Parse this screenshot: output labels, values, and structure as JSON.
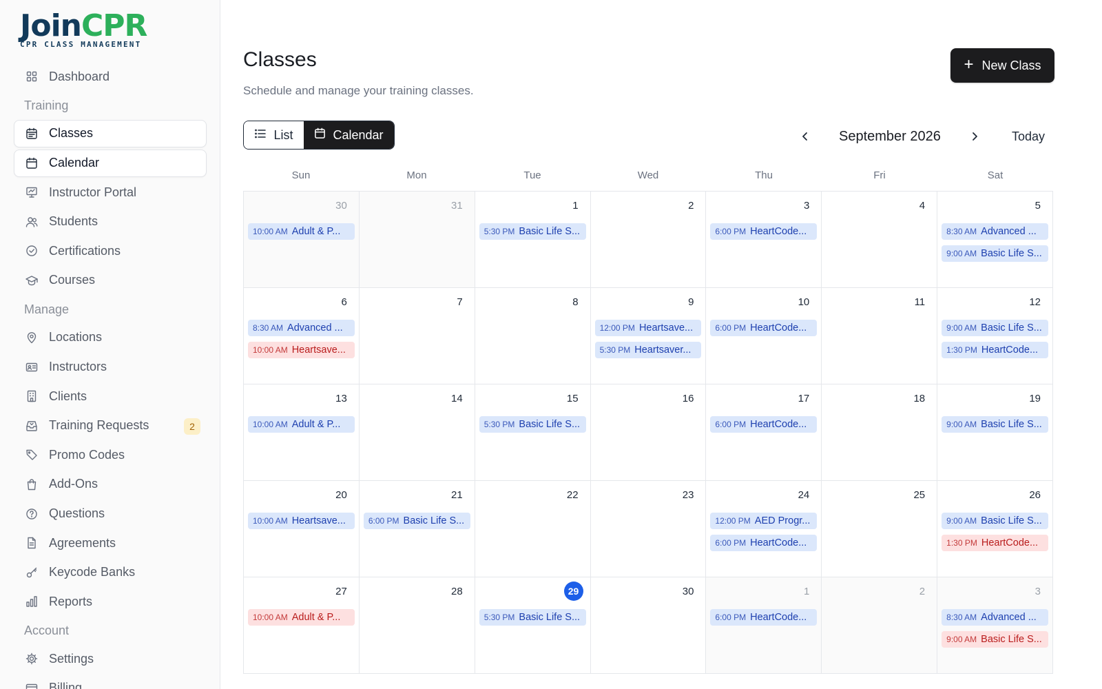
{
  "brand": {
    "word_1": "Join",
    "word_2": "CPR",
    "tagline": "CPR CLASS MANAGEMENT"
  },
  "sidebar": {
    "items": [
      {
        "type": "item",
        "label": "Dashboard",
        "icon": "dashboard-icon"
      },
      {
        "type": "section",
        "label": "Training"
      },
      {
        "type": "item",
        "label": "Classes",
        "icon": "classes-icon",
        "active": true
      },
      {
        "type": "item",
        "label": "Calendar",
        "icon": "calendar-icon",
        "active": true
      },
      {
        "type": "item",
        "label": "Instructor Portal",
        "icon": "presentation-icon"
      },
      {
        "type": "item",
        "label": "Students",
        "icon": "users-icon"
      },
      {
        "type": "item",
        "label": "Certifications",
        "icon": "badge-check-icon"
      },
      {
        "type": "item",
        "label": "Courses",
        "icon": "graduation-cap-icon"
      },
      {
        "type": "section",
        "label": "Manage"
      },
      {
        "type": "item",
        "label": "Locations",
        "icon": "map-pin-icon"
      },
      {
        "type": "item",
        "label": "Instructors",
        "icon": "id-card-icon"
      },
      {
        "type": "item",
        "label": "Clients",
        "icon": "building-icon"
      },
      {
        "type": "item",
        "label": "Training Requests",
        "icon": "inbox-icon",
        "badge": "2"
      },
      {
        "type": "item",
        "label": "Promo Codes",
        "icon": "tag-icon"
      },
      {
        "type": "item",
        "label": "Add-Ons",
        "icon": "shopping-bag-icon"
      },
      {
        "type": "item",
        "label": "Questions",
        "icon": "help-circle-icon"
      },
      {
        "type": "item",
        "label": "Agreements",
        "icon": "file-text-icon"
      },
      {
        "type": "item",
        "label": "Keycode Banks",
        "icon": "key-icon"
      },
      {
        "type": "item",
        "label": "Reports",
        "icon": "bar-chart-icon"
      },
      {
        "type": "section",
        "label": "Account"
      },
      {
        "type": "item",
        "label": "Settings",
        "icon": "gear-icon"
      },
      {
        "type": "item",
        "label": "Billing",
        "icon": "credit-card-icon"
      }
    ]
  },
  "header": {
    "title": "Classes",
    "subtitle": "Schedule and manage your training classes.",
    "new_button_label": "New Class"
  },
  "view_toggle": {
    "list_label": "List",
    "calendar_label": "Calendar",
    "selected": "Calendar"
  },
  "month_nav": {
    "label": "September 2026",
    "today_label": "Today"
  },
  "calendar": {
    "weekdays": [
      "Sun",
      "Mon",
      "Tue",
      "Wed",
      "Thu",
      "Fri",
      "Sat"
    ],
    "today": 29,
    "days": [
      {
        "day": "30",
        "muted": true,
        "events": [
          {
            "time": "10:00 AM",
            "title": "Adult & P...",
            "color": "blue"
          }
        ]
      },
      {
        "day": "31",
        "muted": true,
        "events": []
      },
      {
        "day": "1",
        "events": [
          {
            "time": "5:30 PM",
            "title": "Basic Life S...",
            "color": "blue"
          }
        ]
      },
      {
        "day": "2",
        "events": []
      },
      {
        "day": "3",
        "events": [
          {
            "time": "6:00 PM",
            "title": "HeartCode...",
            "color": "blue"
          }
        ]
      },
      {
        "day": "4",
        "events": []
      },
      {
        "day": "5",
        "events": [
          {
            "time": "8:30 AM",
            "title": "Advanced ...",
            "color": "blue"
          },
          {
            "time": "9:00 AM",
            "title": "Basic Life S...",
            "color": "blue"
          }
        ]
      },
      {
        "day": "6",
        "events": [
          {
            "time": "8:30 AM",
            "title": "Advanced ...",
            "color": "blue"
          },
          {
            "time": "10:00 AM",
            "title": "Heartsave...",
            "color": "red"
          }
        ]
      },
      {
        "day": "7",
        "events": []
      },
      {
        "day": "8",
        "events": []
      },
      {
        "day": "9",
        "events": [
          {
            "time": "12:00 PM",
            "title": "Heartsave...",
            "color": "blue"
          },
          {
            "time": "5:30 PM",
            "title": "Heartsaver...",
            "color": "blue"
          }
        ]
      },
      {
        "day": "10",
        "events": [
          {
            "time": "6:00 PM",
            "title": "HeartCode...",
            "color": "blue"
          }
        ]
      },
      {
        "day": "11",
        "events": []
      },
      {
        "day": "12",
        "events": [
          {
            "time": "9:00 AM",
            "title": "Basic Life S...",
            "color": "blue"
          },
          {
            "time": "1:30 PM",
            "title": "HeartCode...",
            "color": "blue"
          }
        ]
      },
      {
        "day": "13",
        "events": [
          {
            "time": "10:00 AM",
            "title": "Adult & P...",
            "color": "blue"
          }
        ]
      },
      {
        "day": "14",
        "events": []
      },
      {
        "day": "15",
        "events": [
          {
            "time": "5:30 PM",
            "title": "Basic Life S...",
            "color": "blue"
          }
        ]
      },
      {
        "day": "16",
        "events": []
      },
      {
        "day": "17",
        "events": [
          {
            "time": "6:00 PM",
            "title": "HeartCode...",
            "color": "blue"
          }
        ]
      },
      {
        "day": "18",
        "events": []
      },
      {
        "day": "19",
        "events": [
          {
            "time": "9:00 AM",
            "title": "Basic Life S...",
            "color": "blue"
          }
        ]
      },
      {
        "day": "20",
        "events": [
          {
            "time": "10:00 AM",
            "title": "Heartsave...",
            "color": "blue"
          }
        ]
      },
      {
        "day": "21",
        "events": [
          {
            "time": "6:00 PM",
            "title": "Basic Life S...",
            "color": "blue"
          }
        ]
      },
      {
        "day": "22",
        "events": []
      },
      {
        "day": "23",
        "events": []
      },
      {
        "day": "24",
        "events": [
          {
            "time": "12:00 PM",
            "title": "AED Progr...",
            "color": "blue"
          },
          {
            "time": "6:00 PM",
            "title": "HeartCode...",
            "color": "blue"
          }
        ]
      },
      {
        "day": "25",
        "events": []
      },
      {
        "day": "26",
        "events": [
          {
            "time": "9:00 AM",
            "title": "Basic Life S...",
            "color": "blue"
          },
          {
            "time": "1:30 PM",
            "title": "HeartCode...",
            "color": "red"
          }
        ]
      },
      {
        "day": "27",
        "events": [
          {
            "time": "10:00 AM",
            "title": "Adult & P...",
            "color": "red"
          }
        ]
      },
      {
        "day": "28",
        "events": []
      },
      {
        "day": "29",
        "today": true,
        "events": [
          {
            "time": "5:30 PM",
            "title": "Basic Life S...",
            "color": "blue"
          }
        ]
      },
      {
        "day": "30",
        "events": []
      },
      {
        "day": "1",
        "muted": true,
        "events": [
          {
            "time": "6:00 PM",
            "title": "HeartCode...",
            "color": "blue"
          }
        ]
      },
      {
        "day": "2",
        "muted": true,
        "events": []
      },
      {
        "day": "3",
        "muted": true,
        "events": [
          {
            "time": "8:30 AM",
            "title": "Advanced ...",
            "color": "blue"
          },
          {
            "time": "9:00 AM",
            "title": "Basic Life S...",
            "color": "red"
          }
        ]
      }
    ]
  },
  "colors": {
    "accent": "#1d5fe8",
    "event_blue_bg": "#dbe7fb",
    "event_red_bg": "#fde0e0",
    "brand_green": "#2db05b",
    "brand_navy": "#123a5a"
  }
}
